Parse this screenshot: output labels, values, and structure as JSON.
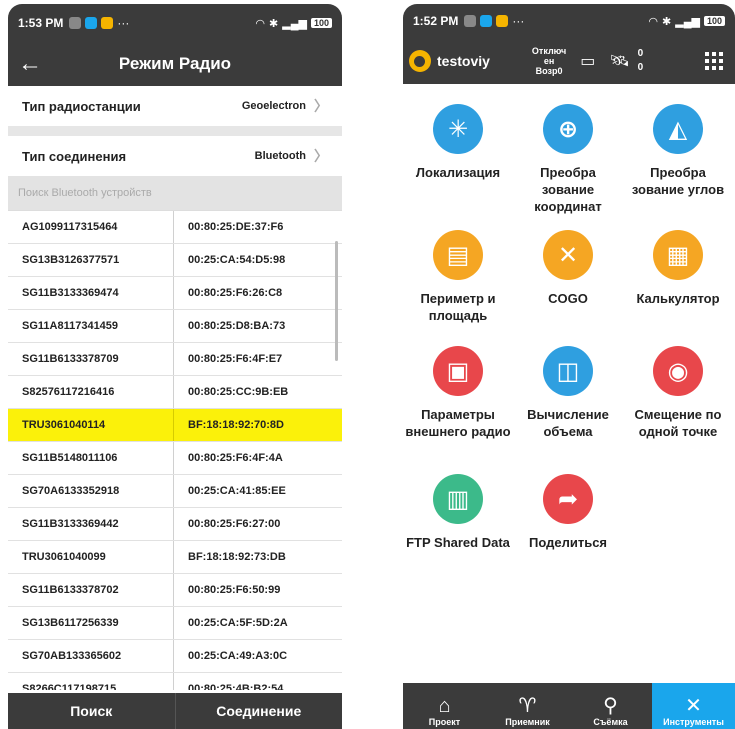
{
  "left": {
    "status": {
      "time": "1:53 PM",
      "dots": "···",
      "battery": "100"
    },
    "title": "Режим Радио",
    "back_icon": "arrow-left-icon",
    "radio_type": {
      "label": "Тип радиостанции",
      "value": "Geoelectron"
    },
    "conn_type": {
      "label": "Тип соединения",
      "value": "Bluetooth"
    },
    "search_hint": "Поиск Bluetooth устройств",
    "devices": [
      {
        "name": "AG1099117315464",
        "mac": "00:80:25:DE:37:F6"
      },
      {
        "name": "SG13B3126377571",
        "mac": "00:25:CA:54:D5:98"
      },
      {
        "name": "SG11B3133369474",
        "mac": "00:80:25:F6:26:C8"
      },
      {
        "name": "SG11A8117341459",
        "mac": "00:80:25:D8:BA:73"
      },
      {
        "name": "SG11B6133378709",
        "mac": "00:80:25:F6:4F:E7"
      },
      {
        "name": "S82576117216416",
        "mac": "00:80:25:CC:9B:EB"
      },
      {
        "name": "TRU3061040114",
        "mac": "BF:18:18:92:70:8D",
        "selected": true
      },
      {
        "name": "SG11B5148011106",
        "mac": "00:80:25:F6:4F:4A"
      },
      {
        "name": "SG70A6133352918",
        "mac": "00:25:CA:41:85:EE"
      },
      {
        "name": "SG11B3133369442",
        "mac": "00:80:25:F6:27:00"
      },
      {
        "name": "TRU3061040099",
        "mac": "BF:18:18:92:73:DB"
      },
      {
        "name": "SG11B6133378702",
        "mac": "00:80:25:F6:50:99"
      },
      {
        "name": "SG13B6117256339",
        "mac": "00:25:CA:5F:5D:2A"
      },
      {
        "name": "SG70AB133365602",
        "mac": "00:25:CA:49:A3:0C"
      },
      {
        "name": "S8266C117198715",
        "mac": "00:80:25:4B:B2:54"
      }
    ],
    "buttons": {
      "search": "Поиск",
      "connect": "Соединение"
    }
  },
  "right": {
    "status": {
      "time": "1:52 PM",
      "dots": "···",
      "battery": "100"
    },
    "project": "testoviy",
    "connection": [
      "Отключ",
      "ен",
      "Возр0"
    ],
    "counts": [
      "0",
      "0"
    ],
    "tools": [
      {
        "id": "localization",
        "label": "Локализация",
        "icon": "localization-icon",
        "glyph": "✳",
        "color": "#2f9fe0"
      },
      {
        "id": "coord-transform",
        "label": "Преобра зование координат",
        "icon": "coordinate-transform-icon",
        "glyph": "⊕",
        "color": "#2f9fe0"
      },
      {
        "id": "angle-transform",
        "label": "Преобра зование углов",
        "icon": "angle-transform-icon",
        "glyph": "◭",
        "color": "#2f9fe0"
      },
      {
        "id": "perimeter",
        "label": "Периметр и площадь",
        "icon": "perimeter-area-icon",
        "glyph": "▤",
        "color": "#f5a623"
      },
      {
        "id": "cogo",
        "label": "COGO",
        "icon": "cogo-icon",
        "glyph": "✕",
        "color": "#f5a623"
      },
      {
        "id": "calculator",
        "label": "Калькулятор",
        "icon": "calculator-icon",
        "glyph": "▦",
        "color": "#f5a623"
      },
      {
        "id": "ext-radio",
        "label": "Параметры внешнего радио",
        "icon": "radio-icon",
        "glyph": "▣",
        "color": "#e8474b"
      },
      {
        "id": "volume",
        "label": "Вычисление объема",
        "icon": "volume-icon",
        "glyph": "◫",
        "color": "#2f9fe0"
      },
      {
        "id": "offset",
        "label": "Смещение по одной точке",
        "icon": "offset-point-icon",
        "glyph": "◉",
        "color": "#e8474b"
      },
      {
        "id": "ftp",
        "label": "FTP Shared Data",
        "icon": "ftp-icon",
        "glyph": "▥",
        "color": "#3cba8a"
      },
      {
        "id": "share",
        "label": "Поделиться",
        "icon": "share-icon",
        "glyph": "➦",
        "color": "#e8474b"
      }
    ],
    "tabs": [
      {
        "label": "Проект",
        "icon": "home-icon",
        "glyph": "⌂"
      },
      {
        "label": "Приемник",
        "icon": "receiver-icon",
        "glyph": "♈"
      },
      {
        "label": "Съёмка",
        "icon": "location-pin-icon",
        "glyph": "⚲"
      },
      {
        "label": "Инструменты",
        "icon": "tools-icon",
        "glyph": "✕",
        "active": true
      }
    ]
  }
}
